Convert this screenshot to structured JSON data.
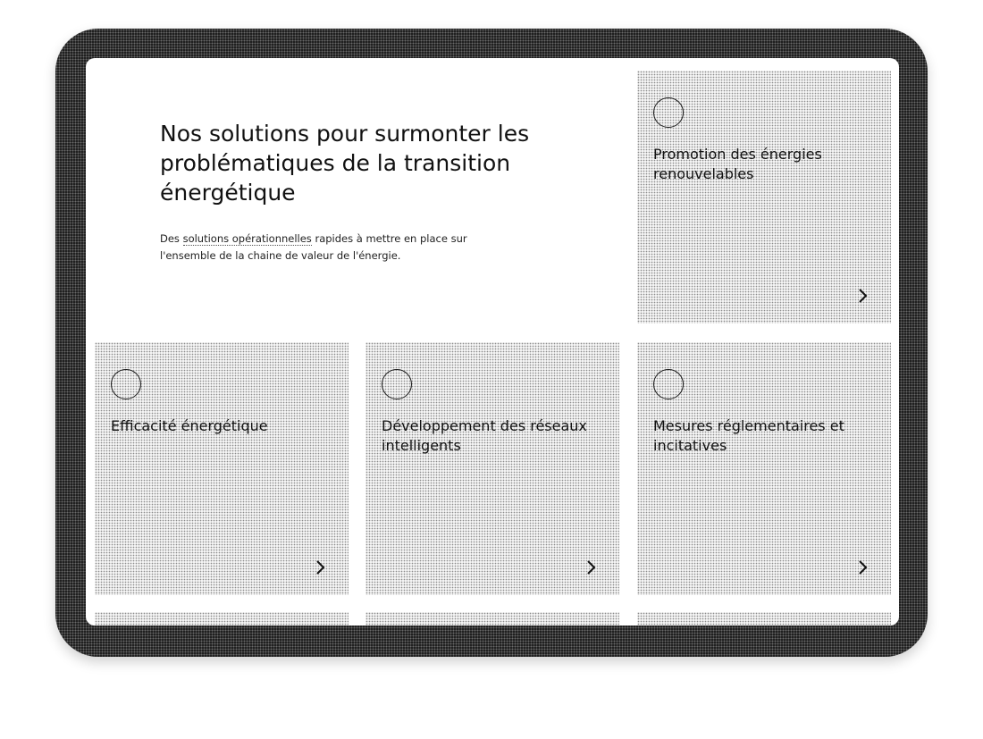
{
  "hero": {
    "title": "Nos solutions pour surmonter les problématiques de la transition énergétique",
    "subtitle_before": "Des ",
    "subtitle_link": "solutions opérationnelles",
    "subtitle_after": " rapides à mettre en place sur l'ensemble de la chaine de valeur de l'énergie."
  },
  "cards": [
    {
      "label": "Promotion des énergies renouvelables",
      "icon": "circle-icon",
      "arrow": "chevron-right-icon"
    },
    {
      "label": "Efficacité énergétique",
      "icon": "circle-icon",
      "arrow": "chevron-right-icon"
    },
    {
      "label": "Développement des réseaux intelligents",
      "icon": "circle-icon",
      "arrow": "chevron-right-icon"
    },
    {
      "label": "Mesures réglementaires et incitatives",
      "icon": "circle-icon",
      "arrow": "chevron-right-icon"
    }
  ],
  "colors": {
    "card_background": "#f4f4f4",
    "frame": "#1c1c1c",
    "text": "#111111"
  }
}
